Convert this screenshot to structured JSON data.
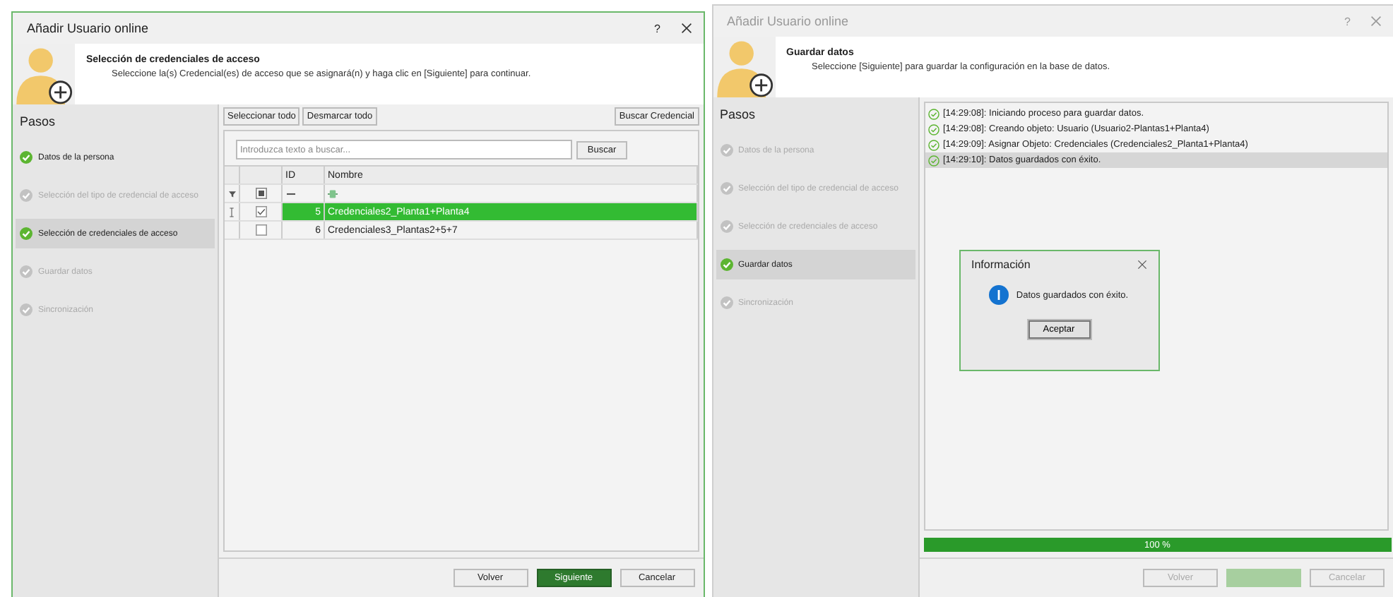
{
  "dialogs": [
    {
      "kind": "credential_selection",
      "title": "Añadir Usuario online",
      "active": true,
      "help": "?",
      "header": {
        "title": "Selección de credenciales de acceso",
        "subtitle": "Seleccione la(s) Credencial(es) de acceso que se asignará(n) y haga clic en [Siguiente] para continuar."
      },
      "steps_title": "Pasos",
      "steps": [
        {
          "label": "Datos de la persona",
          "done": true,
          "selected": false
        },
        {
          "label": "Selección del tipo de credencial de acceso",
          "done": false,
          "selected": false
        },
        {
          "label": "Selección de credenciales de acceso",
          "done": true,
          "selected": true
        },
        {
          "label": "Guardar datos",
          "done": false,
          "selected": false
        },
        {
          "label": "Sincronización",
          "done": false,
          "selected": false
        }
      ],
      "toolbar": [
        "Seleccionar todo",
        "Desmarcar todo"
      ],
      "search_credential_button": "Buscar Credencial",
      "search": {
        "placeholder": "Introduzca texto a buscar...",
        "button": "Buscar"
      },
      "table": {
        "columns": [
          "ID",
          "Nombre"
        ],
        "rows": [
          {
            "id": "5",
            "name": "Credenciales2_Planta1+Planta4",
            "checked": true,
            "selected": true
          },
          {
            "id": "6",
            "name": "Credenciales3_Plantas2+5+7",
            "checked": false,
            "selected": false
          }
        ]
      },
      "buttons": [
        {
          "label": "Volver",
          "kind": "default",
          "disabled": false
        },
        {
          "label": "Siguiente",
          "kind": "primary",
          "disabled": false
        },
        {
          "label": "Cancelar",
          "kind": "default",
          "disabled": false
        }
      ]
    },
    {
      "kind": "save_log",
      "title": "Añadir Usuario online",
      "active": false,
      "help": "?",
      "header": {
        "title": "Guardar datos",
        "subtitle": "Seleccione [Siguiente] para guardar la configuración en la base de datos."
      },
      "steps_title": "Pasos",
      "steps": [
        {
          "label": "Datos de la persona",
          "done": false,
          "selected": false
        },
        {
          "label": "Selección del tipo de credencial de acceso",
          "done": false,
          "selected": false
        },
        {
          "label": "Selección de credenciales de acceso",
          "done": false,
          "selected": false
        },
        {
          "label": "Guardar datos",
          "done": true,
          "selected": true
        },
        {
          "label": "Sincronización",
          "done": false,
          "selected": false
        }
      ],
      "log": [
        {
          "text": "[14:29:08]: Iniciando proceso para guardar datos.",
          "selected": false
        },
        {
          "text": "[14:29:08]: Creando objeto: Usuario (Usuario2-Plantas1+Planta4)",
          "selected": false
        },
        {
          "text": "[14:29:09]: Asignar Objeto: Credenciales (Credenciales2_Planta1+Planta4)",
          "selected": false
        },
        {
          "text": "[14:29:10]: Datos guardados con éxito.",
          "selected": true
        }
      ],
      "progress": {
        "level": 1,
        "label": "100 %"
      },
      "message_box": {
        "title": "Información",
        "message": "Datos guardados con éxito.",
        "button": "Aceptar"
      },
      "buttons": [
        {
          "label": "Volver",
          "kind": "default",
          "disabled": true
        },
        {
          "kind": "primary",
          "disabled": true
        },
        {
          "label": "Cancelar",
          "kind": "default",
          "disabled": true
        }
      ]
    }
  ]
}
